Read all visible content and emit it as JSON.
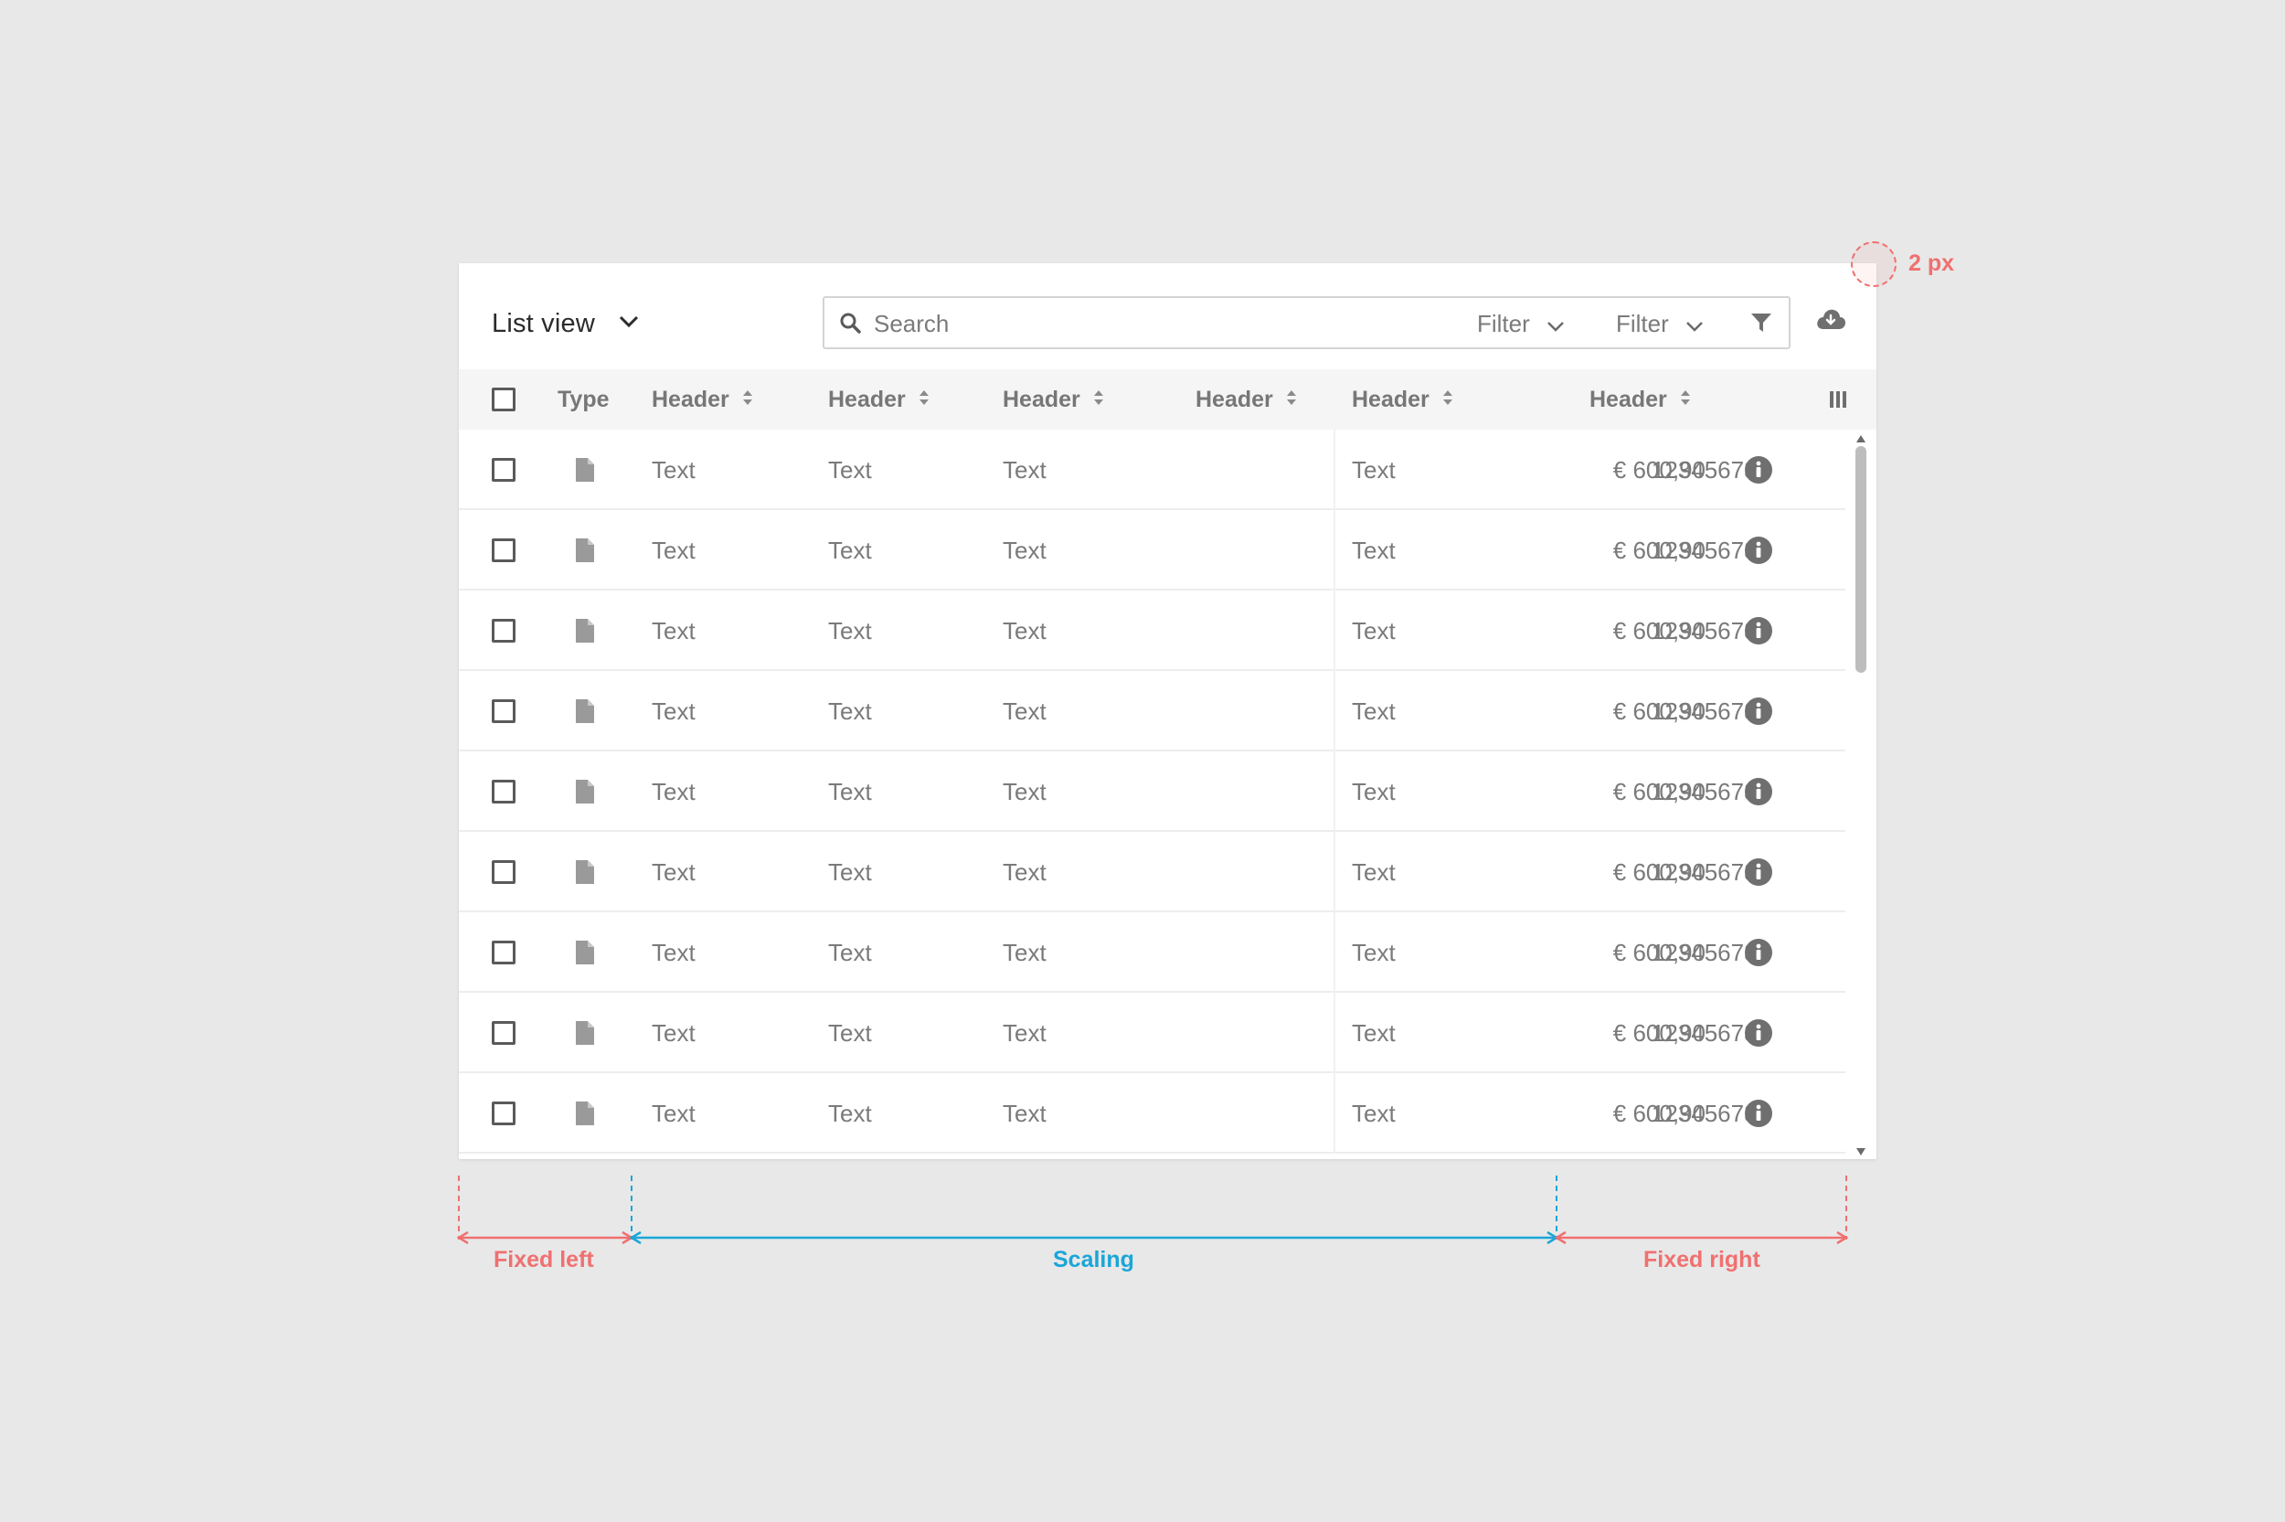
{
  "toolbar": {
    "view_label": "List view",
    "search_placeholder": "Search",
    "filter1_label": "Filter",
    "filter2_label": "Filter"
  },
  "table": {
    "headers": [
      "Type",
      "Header",
      "Header",
      "Header",
      "Header",
      "Header",
      "Header"
    ],
    "rows": [
      [
        "Text",
        "Text",
        "Text",
        "123456789",
        "Text",
        "€ 600,90"
      ],
      [
        "Text",
        "Text",
        "Text",
        "123456789",
        "Text",
        "€ 600,90"
      ],
      [
        "Text",
        "Text",
        "Text",
        "123456789",
        "Text",
        "€ 600,90"
      ],
      [
        "Text",
        "Text",
        "Text",
        "123456789",
        "Text",
        "€ 600,90"
      ],
      [
        "Text",
        "Text",
        "Text",
        "123456789",
        "Text",
        "€ 600,90"
      ],
      [
        "Text",
        "Text",
        "Text",
        "123456789",
        "Text",
        "€ 600,90"
      ],
      [
        "Text",
        "Text",
        "Text",
        "123456789",
        "Text",
        "€ 600,90"
      ],
      [
        "Text",
        "Text",
        "Text",
        "123456789",
        "Text",
        "€ 600,90"
      ],
      [
        "Text",
        "Text",
        "Text",
        "123456789",
        "Text",
        "€ 600,90"
      ]
    ],
    "row_icons": {
      "type": "document-icon",
      "action": "info-icon"
    }
  },
  "annotations": {
    "radius": "2 px",
    "fixed_left": "Fixed left",
    "scaling": "Scaling",
    "fixed_right": "Fixed right"
  },
  "colors": {
    "background": "#e8e8e8",
    "card": "#ffffff",
    "header_bg": "#f5f5f5",
    "annotation_red": "#f07070",
    "annotation_blue": "#1aa6d8",
    "icon_gray": "#6f6f6f"
  }
}
